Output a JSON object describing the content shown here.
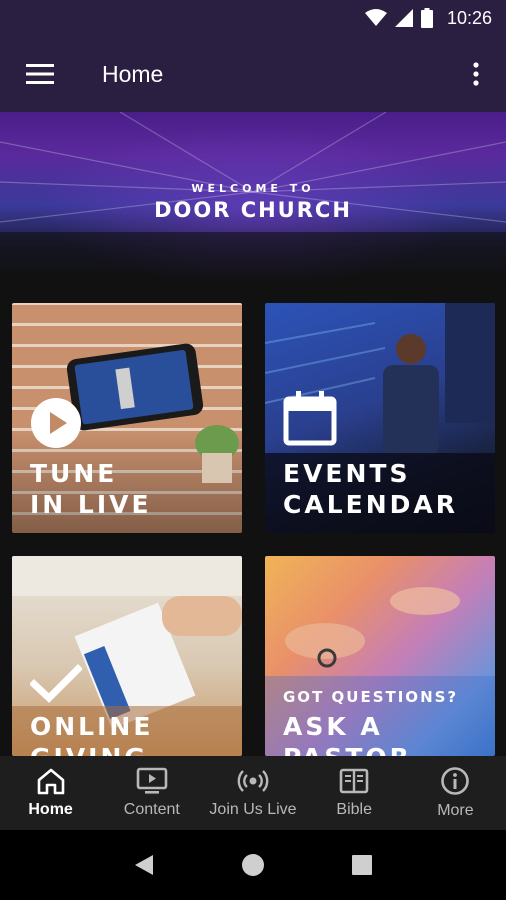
{
  "status_bar": {
    "time": "10:26"
  },
  "app_bar": {
    "title": "Home"
  },
  "hero": {
    "welcome": "WELCOME TO",
    "title": "DOOR CHURCH"
  },
  "tiles": [
    {
      "label": "TUNE\nIN LIVE"
    },
    {
      "label": "EVENTS\nCALENDAR"
    },
    {
      "label": "ONLINE\nGIVING"
    },
    {
      "subtitle": "GOT QUESTIONS?",
      "label": "ASK A\nPASTOR"
    }
  ],
  "bottom_nav": [
    {
      "label": "Home",
      "icon": "home-icon",
      "active": true
    },
    {
      "label": "Content",
      "icon": "tv-icon"
    },
    {
      "label": "Join Us Live",
      "icon": "broadcast-icon"
    },
    {
      "label": "Bible",
      "icon": "book-icon"
    },
    {
      "label": "More",
      "icon": "info-icon"
    }
  ],
  "colors": {
    "app_bar": "#2a1f40",
    "background": "#111111",
    "nav_bar": "#1e1e1e"
  }
}
